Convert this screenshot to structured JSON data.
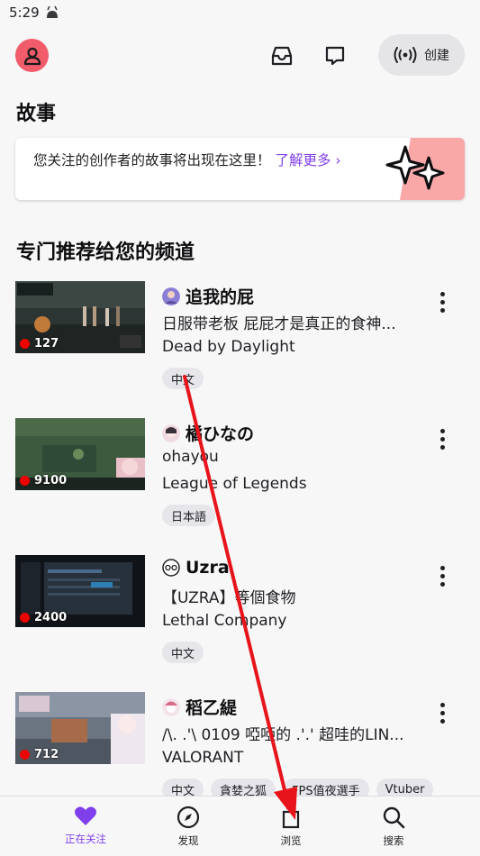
{
  "status_bar": {
    "time": "5:29"
  },
  "top_bar": {
    "create_label": "创建"
  },
  "stories": {
    "title": "故事",
    "text": "您关注的创作者的故事将出现在这里！",
    "link": "了解更多"
  },
  "recommended": {
    "title": "专门推荐给您的频道",
    "channels": [
      {
        "name": "追我的屁",
        "title": "日服带老板 屁屁才是真正的食神...",
        "game": "Dead by Daylight",
        "viewers": "127",
        "tags": [
          "中文"
        ]
      },
      {
        "name": "橘ひなの",
        "title": "ohayou",
        "game": "League of Legends",
        "viewers": "9100",
        "tags": [
          "日本語"
        ]
      },
      {
        "name": "Uzra",
        "title": "【UZRA】等個食物",
        "game": "Lethal Company",
        "viewers": "2400",
        "tags": [
          "中文"
        ]
      },
      {
        "name": "稻乙緹",
        "title": "/\\. .'\\ 0109 啞啞的 .'.' 超哇的LIN...",
        "game": "VALORANT",
        "viewers": "712",
        "tags": [
          "中文",
          "貪婪之狐",
          "FPS值夜選手",
          "Vtuber"
        ]
      }
    ]
  },
  "bottom_nav": {
    "following": "正在关注",
    "discover": "发现",
    "browse": "浏览",
    "search": "搜索"
  },
  "colors": {
    "accent": "#7f3fea",
    "live": "#eb0400",
    "avatar": "#f05c6a",
    "arrow": "#e8141b"
  },
  "icons": [
    "android-icon",
    "user-icon",
    "inbox-icon",
    "chat-icon",
    "broadcast-icon",
    "sparkle-icon",
    "more-icon",
    "heart-icon",
    "compass-icon",
    "browse-icon",
    "search-icon"
  ]
}
